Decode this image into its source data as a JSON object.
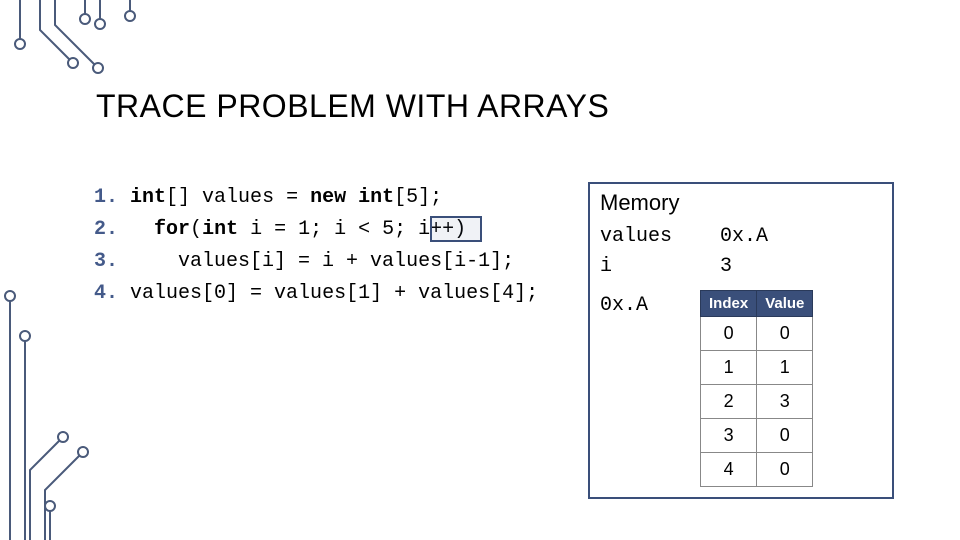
{
  "title": "TRACE PROBLEM WITH ARRAYS",
  "code": {
    "lines": [
      {
        "n": "1.",
        "text": "int[] values = new int[5];"
      },
      {
        "n": "2.",
        "text": "  for(int i = 1; i < 5; i++)"
      },
      {
        "n": "3.",
        "text": "    values[i] = i + values[i-1];"
      },
      {
        "n": "4.",
        "text": "values[0] = values[1] + values[4];"
      }
    ]
  },
  "memory": {
    "heading": "Memory",
    "vars": [
      {
        "name": "values",
        "value": "0x.A"
      },
      {
        "name": "i",
        "value": "3"
      }
    ],
    "array_addr": "0x.A",
    "table": {
      "headers": [
        "Index",
        "Value"
      ],
      "rows": [
        [
          "0",
          "0"
        ],
        [
          "1",
          "1"
        ],
        [
          "2",
          "3"
        ],
        [
          "3",
          "0"
        ],
        [
          "4",
          "0"
        ]
      ]
    }
  },
  "chart_data": {
    "type": "table",
    "title": "Array contents at address 0x.A",
    "columns": [
      "Index",
      "Value"
    ],
    "rows": [
      [
        0,
        0
      ],
      [
        1,
        1
      ],
      [
        2,
        3
      ],
      [
        3,
        0
      ],
      [
        4,
        0
      ]
    ],
    "scalars": {
      "values": "0x.A",
      "i": 3
    }
  }
}
